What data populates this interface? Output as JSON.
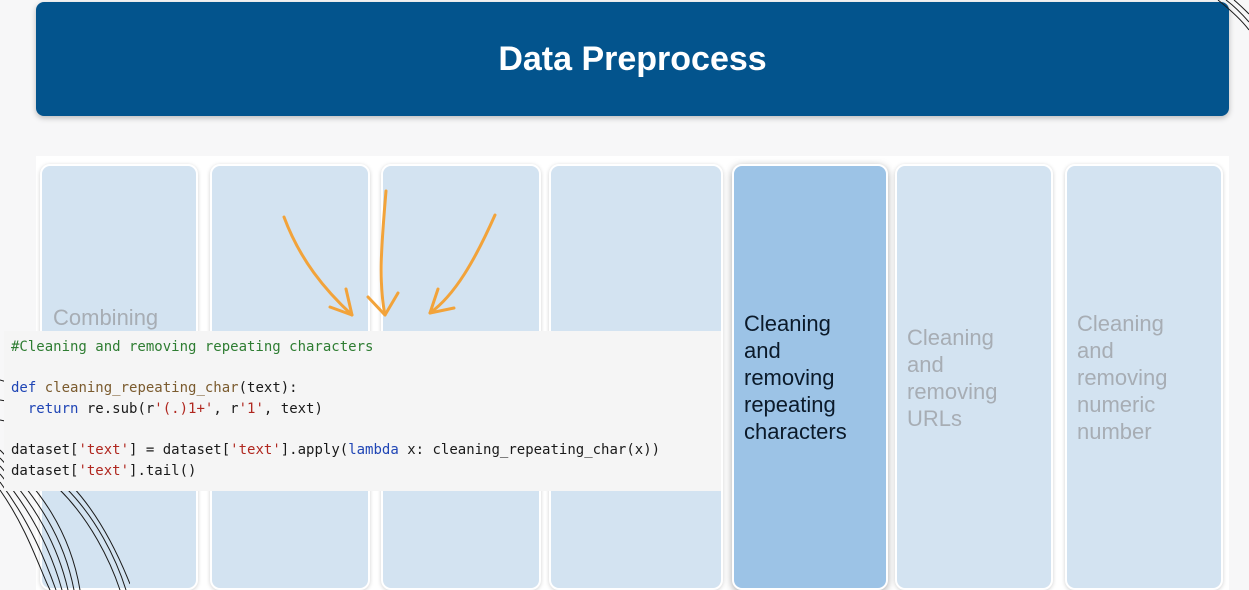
{
  "slide": {
    "title": "Data Preprocess"
  },
  "cards": [
    {
      "label": "Combining",
      "active": false
    },
    {
      "label": "",
      "active": false
    },
    {
      "label": "",
      "active": false
    },
    {
      "label": "",
      "active": false
    },
    {
      "label": "Cleaning\nand\nremoving\nrepeating\ncharacters",
      "active": true
    },
    {
      "label": "Cleaning\nand\nremoving\nURLs",
      "active": false
    },
    {
      "label": "Cleaning\nand\nremoving\nnumeric\nnumber",
      "active": false
    }
  ],
  "code": {
    "line1": "#Cleaning and removing repeating characters",
    "line3_kw": "def",
    "line3_fn": "cleaning_repeating_char",
    "line3_rest": "(text):",
    "line4_kw": "return",
    "line4_a": " re.sub(r",
    "line4_s1": "'(.)1+'",
    "line4_b": ", r",
    "line4_s2": "'1'",
    "line4_c": ", text)",
    "line6_a": "dataset[",
    "line6_s1": "'text'",
    "line6_b": "] = dataset[",
    "line6_s2": "'text'",
    "line6_c": "].apply(",
    "line6_kw": "lambda",
    "line6_d": " x: cleaning_repeating_char(x))",
    "line7_a": "dataset[",
    "line7_s": "'text'",
    "line7_b": "].tail()"
  },
  "colors": {
    "header": "#03548d",
    "card": "#d3e3f1",
    "card_active": "#9cc3e6",
    "arrow": "#f2a33a"
  }
}
